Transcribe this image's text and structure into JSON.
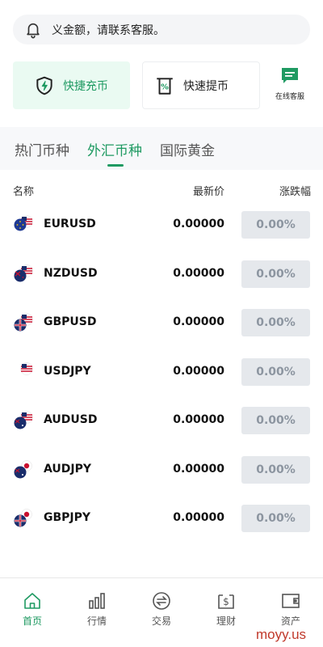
{
  "notice": {
    "text": "义金额，请联系客服。",
    "icon": "bell-icon"
  },
  "quick_actions": {
    "charge": {
      "label": "快捷充币",
      "icon": "shield-bolt-icon"
    },
    "withdraw": {
      "label": "快速提币",
      "icon": "atm-withdraw-icon"
    },
    "support": {
      "label": "在线客服",
      "icon": "chat-icon"
    }
  },
  "tabs": [
    {
      "label": "热门币种",
      "active": false
    },
    {
      "label": "外汇币种",
      "active": true
    },
    {
      "label": "国际黄金",
      "active": false
    }
  ],
  "table": {
    "headers": {
      "name": "名称",
      "price": "最新价",
      "change": "涨跌幅"
    },
    "rows": [
      {
        "symbol": "EURUSD",
        "price": "0.00000",
        "change": "0.00%",
        "flag": "eu-us-flag-icon"
      },
      {
        "symbol": "NZDUSD",
        "price": "0.00000",
        "change": "0.00%",
        "flag": "nz-us-flag-icon"
      },
      {
        "symbol": "GBPUSD",
        "price": "0.00000",
        "change": "0.00%",
        "flag": "gb-us-flag-icon"
      },
      {
        "symbol": "USDJPY",
        "price": "0.00000",
        "change": "0.00%",
        "flag": "us-jp-flag-icon"
      },
      {
        "symbol": "AUDUSD",
        "price": "0.00000",
        "change": "0.00%",
        "flag": "au-us-flag-icon"
      },
      {
        "symbol": "AUDJPY",
        "price": "0.00000",
        "change": "0.00%",
        "flag": "au-jp-flag-icon"
      },
      {
        "symbol": "GBPJPY",
        "price": "0.00000",
        "change": "0.00%",
        "flag": "gb-jp-flag-icon"
      }
    ]
  },
  "bottom_nav": [
    {
      "label": "首页",
      "icon": "home-icon",
      "active": true
    },
    {
      "label": "行情",
      "icon": "bar-chart-icon",
      "active": false
    },
    {
      "label": "交易",
      "icon": "exchange-icon",
      "active": false
    },
    {
      "label": "理财",
      "icon": "wealth-icon",
      "active": false
    },
    {
      "label": "资产",
      "icon": "wallet-icon",
      "active": false
    }
  ],
  "watermark": "moyy.us",
  "colors": {
    "accent": "#1f9a62",
    "accent_bg": "#eafaf2",
    "change_bg": "#e5e8ec",
    "change_text": "#8c95a0"
  }
}
